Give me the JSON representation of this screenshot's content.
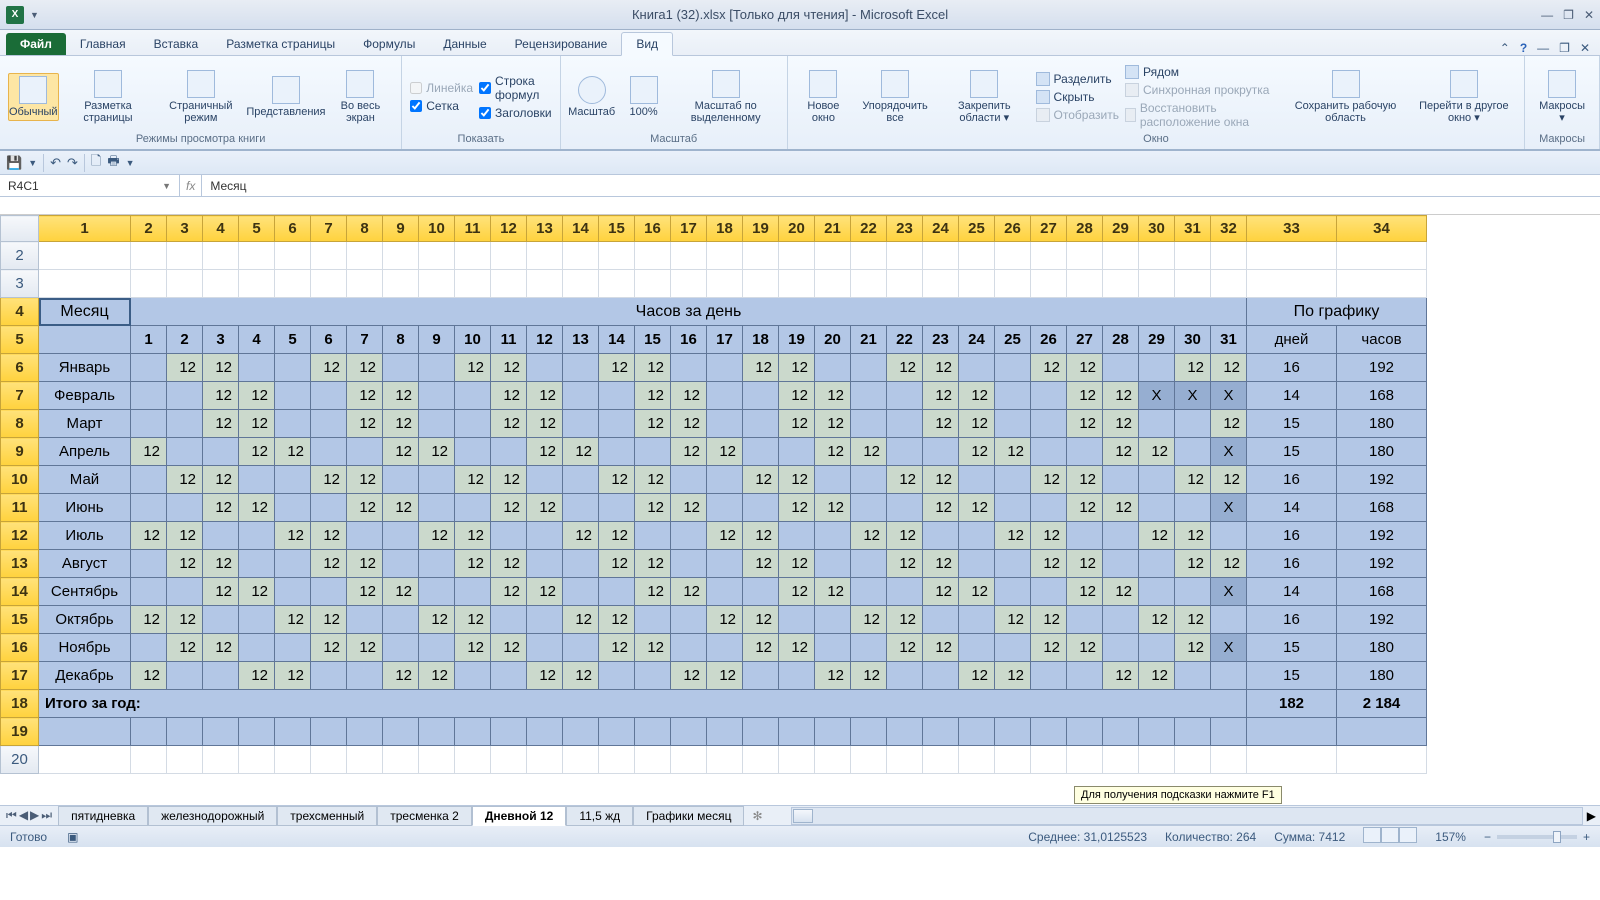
{
  "title": "Книга1 (32).xlsx  [Только для чтения]  -  Microsoft Excel",
  "tabs": {
    "file": "Файл",
    "items": [
      "Главная",
      "Вставка",
      "Разметка страницы",
      "Формулы",
      "Данные",
      "Рецензирование",
      "Вид"
    ]
  },
  "ribbon": {
    "views": {
      "normal": "Обычный",
      "page": "Разметка\nстраницы",
      "pagebrk": "Страничный\nрежим",
      "custom": "Представления",
      "full": "Во весь\nэкран",
      "label": "Режимы просмотра книги"
    },
    "show": {
      "ruler": "Линейка",
      "formulabar": "Строка формул",
      "grid": "Сетка",
      "headings": "Заголовки",
      "label": "Показать"
    },
    "zoom": {
      "zoom": "Масштаб",
      "p100": "100%",
      "sel": "Масштаб по\nвыделенному",
      "label": "Масштаб"
    },
    "window": {
      "newwin": "Новое\nокно",
      "arrange": "Упорядочить\nвсе",
      "freeze": "Закрепить\nобласти ▾",
      "split": "Разделить",
      "hide": "Скрыть",
      "unhide": "Отобразить",
      "side": "Рядом",
      "sync": "Синхронная прокрутка",
      "reset": "Восстановить расположение окна",
      "save": "Сохранить\nрабочую область",
      "switch": "Перейти в\nдругое окно ▾",
      "label": "Окно"
    },
    "macros": {
      "btn": "Макросы\n▾",
      "label": "Макросы"
    }
  },
  "namebox": "R4C1",
  "formula": "Месяц",
  "cols": [
    "1",
    "2",
    "3",
    "4",
    "5",
    "6",
    "7",
    "8",
    "9",
    "10",
    "11",
    "12",
    "13",
    "14",
    "15",
    "16",
    "17",
    "18",
    "19",
    "20",
    "21",
    "22",
    "23",
    "24",
    "25",
    "26",
    "27",
    "28",
    "29",
    "30",
    "31",
    "32",
    "33",
    "34"
  ],
  "header": {
    "month": "Месяц",
    "perday": "Часов за день",
    "graph": "По графику",
    "days": "дней",
    "hours": "часов"
  },
  "daynums": [
    "1",
    "2",
    "3",
    "4",
    "5",
    "6",
    "7",
    "8",
    "9",
    "10",
    "11",
    "12",
    "13",
    "14",
    "15",
    "16",
    "17",
    "18",
    "19",
    "20",
    "21",
    "22",
    "23",
    "24",
    "25",
    "26",
    "27",
    "28",
    "29",
    "30",
    "31"
  ],
  "months": [
    {
      "n": "Январь",
      "d": [
        0,
        1,
        1,
        0,
        0,
        1,
        1,
        0,
        0,
        1,
        1,
        0,
        0,
        1,
        1,
        0,
        0,
        1,
        1,
        0,
        0,
        1,
        1,
        0,
        0,
        1,
        1,
        0,
        0,
        1,
        1
      ],
      "days": "16",
      "hrs": "192"
    },
    {
      "n": "Февраль",
      "d": [
        0,
        0,
        1,
        1,
        0,
        0,
        1,
        1,
        0,
        0,
        1,
        1,
        0,
        0,
        1,
        1,
        0,
        0,
        1,
        1,
        0,
        0,
        1,
        1,
        0,
        0,
        1,
        1,
        2,
        2,
        2
      ],
      "days": "14",
      "hrs": "168"
    },
    {
      "n": "Март",
      "d": [
        0,
        0,
        1,
        1,
        0,
        0,
        1,
        1,
        0,
        0,
        1,
        1,
        0,
        0,
        1,
        1,
        0,
        0,
        1,
        1,
        0,
        0,
        1,
        1,
        0,
        0,
        1,
        1,
        0,
        0,
        1
      ],
      "days": "15",
      "hrs": "180"
    },
    {
      "n": "Апрель",
      "d": [
        1,
        0,
        0,
        1,
        1,
        0,
        0,
        1,
        1,
        0,
        0,
        1,
        1,
        0,
        0,
        1,
        1,
        0,
        0,
        1,
        1,
        0,
        0,
        1,
        1,
        0,
        0,
        1,
        1,
        0,
        2
      ],
      "days": "15",
      "hrs": "180"
    },
    {
      "n": "Май",
      "d": [
        0,
        1,
        1,
        0,
        0,
        1,
        1,
        0,
        0,
        1,
        1,
        0,
        0,
        1,
        1,
        0,
        0,
        1,
        1,
        0,
        0,
        1,
        1,
        0,
        0,
        1,
        1,
        0,
        0,
        1,
        1
      ],
      "days": "16",
      "hrs": "192"
    },
    {
      "n": "Июнь",
      "d": [
        0,
        0,
        1,
        1,
        0,
        0,
        1,
        1,
        0,
        0,
        1,
        1,
        0,
        0,
        1,
        1,
        0,
        0,
        1,
        1,
        0,
        0,
        1,
        1,
        0,
        0,
        1,
        1,
        0,
        0,
        2
      ],
      "days": "14",
      "hrs": "168"
    },
    {
      "n": "Июль",
      "d": [
        1,
        1,
        0,
        0,
        1,
        1,
        0,
        0,
        1,
        1,
        0,
        0,
        1,
        1,
        0,
        0,
        1,
        1,
        0,
        0,
        1,
        1,
        0,
        0,
        1,
        1,
        0,
        0,
        1,
        1,
        0
      ],
      "days": "16",
      "hrs": "192"
    },
    {
      "n": "Август",
      "d": [
        0,
        1,
        1,
        0,
        0,
        1,
        1,
        0,
        0,
        1,
        1,
        0,
        0,
        1,
        1,
        0,
        0,
        1,
        1,
        0,
        0,
        1,
        1,
        0,
        0,
        1,
        1,
        0,
        0,
        1,
        1
      ],
      "days": "16",
      "hrs": "192"
    },
    {
      "n": "Сентябрь",
      "d": [
        0,
        0,
        1,
        1,
        0,
        0,
        1,
        1,
        0,
        0,
        1,
        1,
        0,
        0,
        1,
        1,
        0,
        0,
        1,
        1,
        0,
        0,
        1,
        1,
        0,
        0,
        1,
        1,
        0,
        0,
        2
      ],
      "days": "14",
      "hrs": "168"
    },
    {
      "n": "Октябрь",
      "d": [
        1,
        1,
        0,
        0,
        1,
        1,
        0,
        0,
        1,
        1,
        0,
        0,
        1,
        1,
        0,
        0,
        1,
        1,
        0,
        0,
        1,
        1,
        0,
        0,
        1,
        1,
        0,
        0,
        1,
        1,
        0
      ],
      "days": "16",
      "hrs": "192"
    },
    {
      "n": "Ноябрь",
      "d": [
        0,
        1,
        1,
        0,
        0,
        1,
        1,
        0,
        0,
        1,
        1,
        0,
        0,
        1,
        1,
        0,
        0,
        1,
        1,
        0,
        0,
        1,
        1,
        0,
        0,
        1,
        1,
        0,
        0,
        1,
        2
      ],
      "days": "15",
      "hrs": "180"
    },
    {
      "n": "Декабрь",
      "d": [
        1,
        0,
        0,
        1,
        1,
        0,
        0,
        1,
        1,
        0,
        0,
        1,
        1,
        0,
        0,
        1,
        1,
        0,
        0,
        1,
        1,
        0,
        0,
        1,
        1,
        0,
        0,
        1,
        1,
        0,
        0
      ],
      "days": "15",
      "hrs": "180"
    }
  ],
  "total": {
    "label": "Итого за год:",
    "days": "182",
    "hrs": "2 184"
  },
  "sheets": [
    "пятидневка",
    "железнодорожный",
    "трехсменный",
    "тресменка 2",
    "Дневной 12",
    "11,5 жд",
    "Графики месяц"
  ],
  "tooltip": "Для получения подсказки нажмите F1",
  "status": {
    "ready": "Готово",
    "avg": "Среднее: 31,0125523",
    "count": "Количество: 264",
    "sum": "Сумма: 7412",
    "zoom": "157%"
  }
}
